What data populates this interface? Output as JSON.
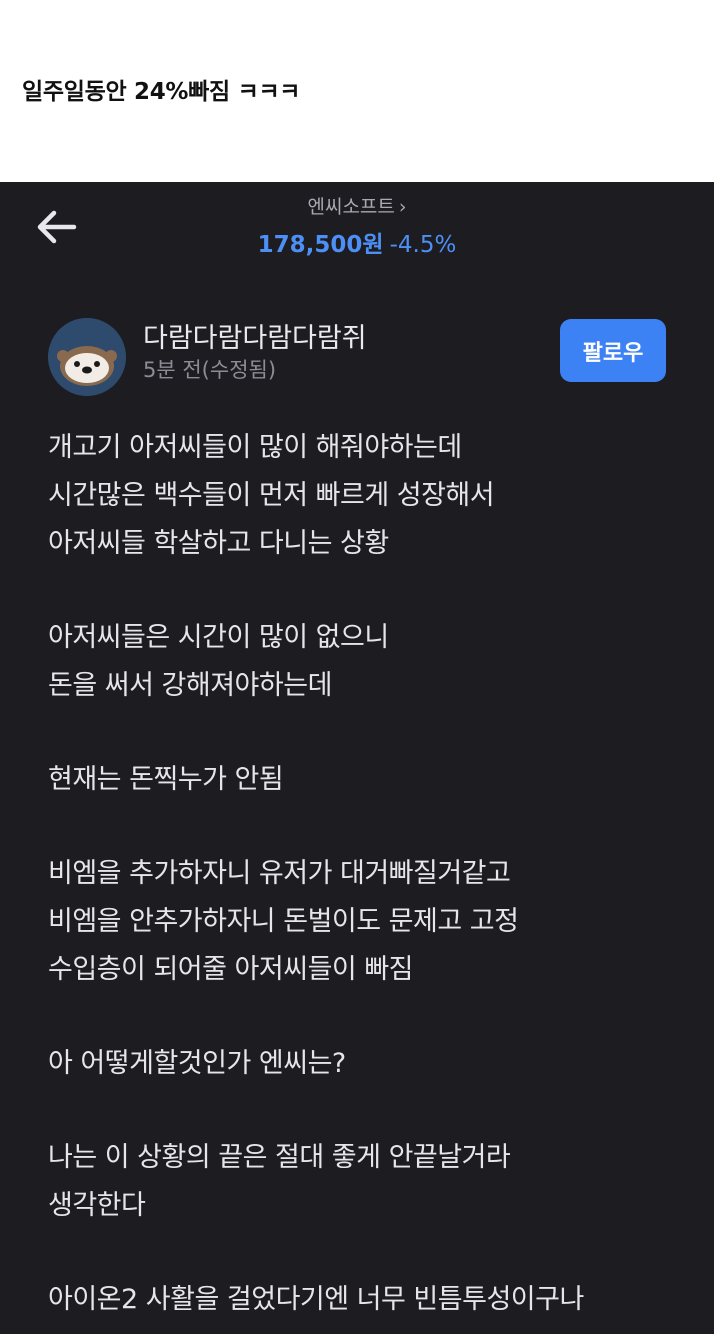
{
  "caption": "일주일동안 24%빠짐 ㅋㅋㅋ",
  "header": {
    "stock_name": "엔씨소프트",
    "stock_price": "178,500원",
    "stock_change": "-4.5%",
    "chevron_icon": "chevron-right-icon",
    "back_icon": "arrow-left-icon"
  },
  "author": {
    "name": "다람다람다람다람쥐",
    "time": "5분 전(수정됨)",
    "follow_label": "팔로우",
    "avatar_icon": "otter-avatar-icon"
  },
  "colors": {
    "background": "#1c1c21",
    "accent": "#3d82f4",
    "price": "#4d8ff5"
  },
  "post": {
    "paragraphs": [
      [
        "개고기 아저씨들이 많이 해줘야하는데",
        "시간많은 백수들이 먼저 빠르게 성장해서",
        "아저씨들 학살하고 다니는 상황"
      ],
      [
        "아저씨들은 시간이 많이 없으니",
        "돈을 써서 강해져야하는데"
      ],
      [
        "현재는 돈찍누가 안됨"
      ],
      [
        "비엠을 추가하자니 유저가 대거빠질거같고",
        "비엠을 안추가하자니 돈벌이도 문제고 고정",
        "수입층이 되어줄 아저씨들이 빠짐"
      ],
      [
        "아 어떻게할것인가 엔씨는?"
      ],
      [
        "나는 이 상황의 끝은 절대 좋게 안끝날거라",
        "생각한다"
      ],
      [
        "아이온2 사활을 걸었다기엔 너무 빈틈투성이구나"
      ]
    ]
  }
}
